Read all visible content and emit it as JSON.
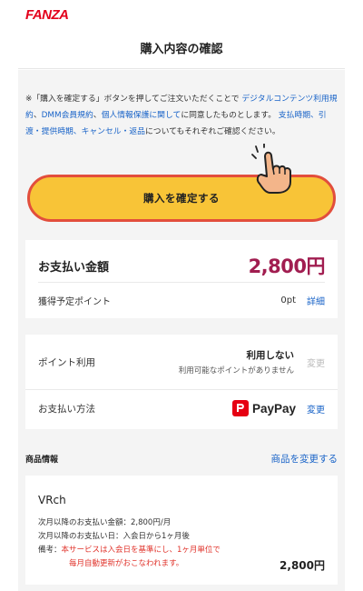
{
  "header": {
    "logo": "FANZA",
    "title": "購入内容の確認"
  },
  "notice": {
    "p1": "※「購入を確定する」ボタンを押してご注文いただくことで ",
    "link1": "デジタルコンテンツ利用規約",
    "p2": "、",
    "link2": "DMM会員規約",
    "p3": "、",
    "link3": "個人情報保護に関して",
    "p4": "に同意したものとします。 ",
    "link4": "支払時期、引渡・提供時期、キャンセル・返品",
    "p5": "についてもそれぞれご確認ください。"
  },
  "cta": {
    "label": "購入を確定する"
  },
  "payment_summary": {
    "label": "お支払い金額",
    "amount": "2,800円",
    "points_label": "獲得予定ポイント",
    "points_value": "0pt",
    "points_detail": "詳細"
  },
  "options": {
    "point_use_label": "ポイント利用",
    "point_use_value": "利用しない",
    "point_use_note": "利用可能なポイントがありません",
    "point_use_change": "変更",
    "method_label": "お支払い方法",
    "method_name": "PayPay",
    "method_change": "変更"
  },
  "product": {
    "section_title": "商品情報",
    "change_link": "商品を変更する",
    "name": "VRch",
    "line1": "次月以降のお支払い金額：2,800円/月",
    "line2": "次月以降のお支払い日：入会日から1ヶ月後",
    "note_label": "備考：",
    "note_red1": "本サービスは入会日を基準にし、1ヶ月単位で",
    "note_red2": "毎月自動更新がおこなわれます。",
    "price": "2,800円"
  },
  "colors": {
    "accent_red": "#e3001b",
    "amount": "#a11d50",
    "link": "#1a64c8",
    "cta_fill": "#f8c437",
    "cta_border": "#e24e3c"
  }
}
